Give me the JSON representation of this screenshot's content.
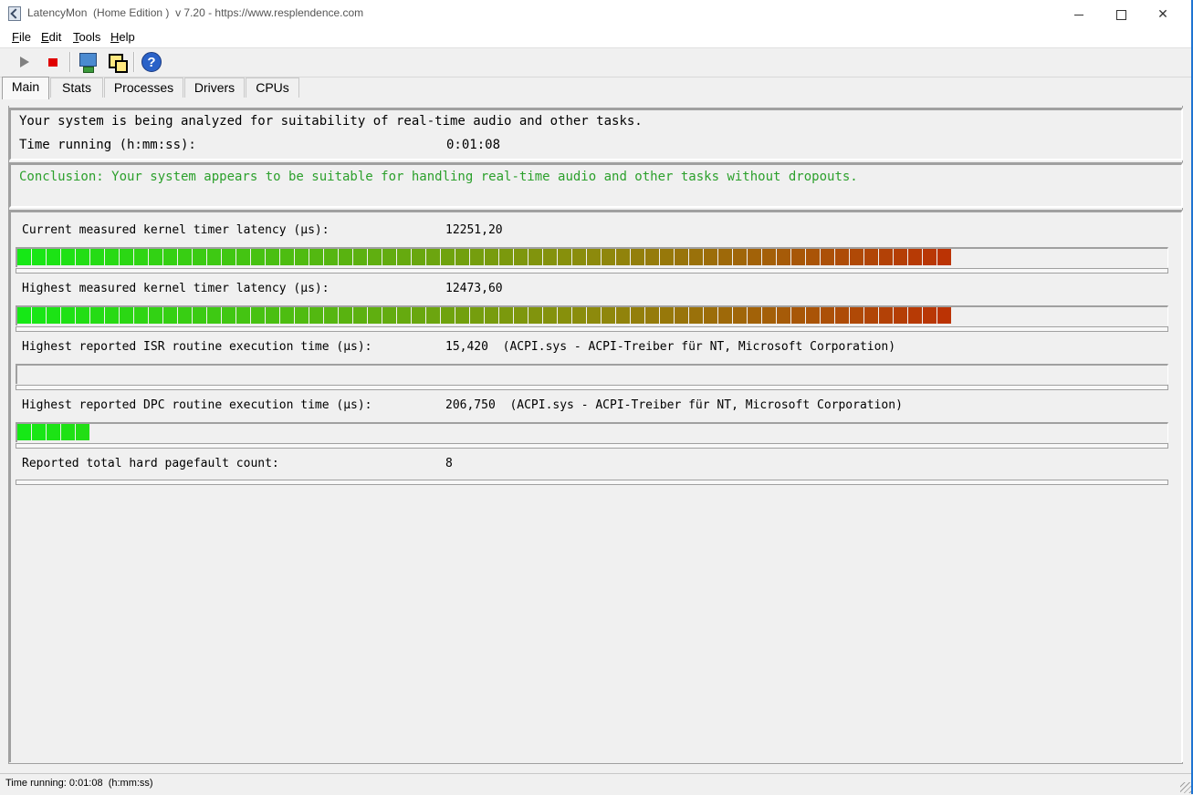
{
  "window": {
    "title": "LatencyMon  (Home Edition )  v 7.20 - https://www.resplendence.com",
    "close_glyph": "✕",
    "accent_color": "#1f74d2"
  },
  "menu": [
    "File",
    "Edit",
    "Tools",
    "Help"
  ],
  "toolbar": {
    "buttons": [
      "play-icon",
      "stop-icon",
      "monitor-icon",
      "windows-icon",
      "help-icon"
    ],
    "help_glyph": "?"
  },
  "tabs": [
    "Main",
    "Stats",
    "Processes",
    "Drivers",
    "CPUs"
  ],
  "active_tab": "Main",
  "analysis": {
    "status_line": "Your system is being analyzed for suitability of real-time audio and other tasks.",
    "time_label": "Time running (h:mm:ss):",
    "time_value": "0:01:08"
  },
  "conclusion": {
    "text": "Conclusion: Your system appears to be suitable for handling real-time audio and other tasks without dropouts.",
    "color": "#2ca02c"
  },
  "metrics": [
    {
      "label": "Current measured kernel timer latency (µs):",
      "value": "12251,20",
      "lit_segments": 64,
      "total_segments": 78
    },
    {
      "label": "Highest measured kernel timer latency (µs):",
      "value": "12473,60",
      "lit_segments": 64,
      "total_segments": 78
    },
    {
      "label": "Highest reported ISR routine execution time (µs):",
      "value": "15,420  (ACPI.sys - ACPI-Treiber für NT, Microsoft Corporation)",
      "lit_segments": 0,
      "total_segments": 78
    },
    {
      "label": "Highest reported DPC routine execution time (µs):",
      "value": "206,750  (ACPI.sys - ACPI-Treiber für NT, Microsoft Corporation)",
      "lit_segments": 5,
      "total_segments": 78
    },
    {
      "label": "Reported total hard pagefault count:",
      "value": "8",
      "lit_segments": 0,
      "total_segments": 0
    }
  ],
  "statusbar": {
    "text": "Time running: 0:01:08  (h:mm:ss)"
  }
}
